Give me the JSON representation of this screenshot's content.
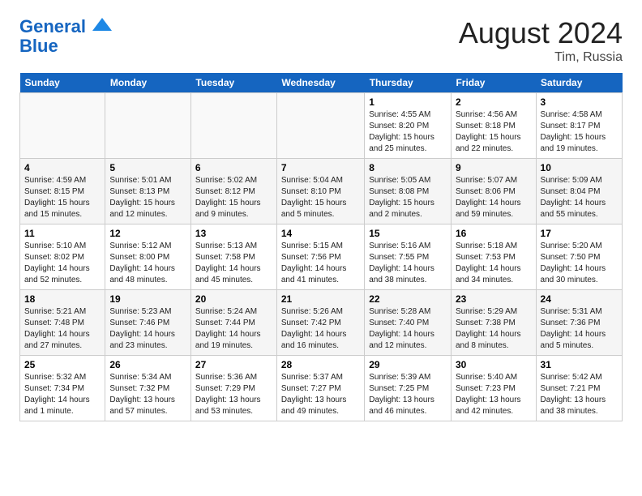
{
  "header": {
    "logo_line1": "General",
    "logo_line2": "Blue",
    "month_year": "August 2024",
    "location": "Tim, Russia"
  },
  "days_of_week": [
    "Sunday",
    "Monday",
    "Tuesday",
    "Wednesday",
    "Thursday",
    "Friday",
    "Saturday"
  ],
  "weeks": [
    [
      {
        "num": "",
        "info": ""
      },
      {
        "num": "",
        "info": ""
      },
      {
        "num": "",
        "info": ""
      },
      {
        "num": "",
        "info": ""
      },
      {
        "num": "1",
        "info": "Sunrise: 4:55 AM\nSunset: 8:20 PM\nDaylight: 15 hours\nand 25 minutes."
      },
      {
        "num": "2",
        "info": "Sunrise: 4:56 AM\nSunset: 8:18 PM\nDaylight: 15 hours\nand 22 minutes."
      },
      {
        "num": "3",
        "info": "Sunrise: 4:58 AM\nSunset: 8:17 PM\nDaylight: 15 hours\nand 19 minutes."
      }
    ],
    [
      {
        "num": "4",
        "info": "Sunrise: 4:59 AM\nSunset: 8:15 PM\nDaylight: 15 hours\nand 15 minutes."
      },
      {
        "num": "5",
        "info": "Sunrise: 5:01 AM\nSunset: 8:13 PM\nDaylight: 15 hours\nand 12 minutes."
      },
      {
        "num": "6",
        "info": "Sunrise: 5:02 AM\nSunset: 8:12 PM\nDaylight: 15 hours\nand 9 minutes."
      },
      {
        "num": "7",
        "info": "Sunrise: 5:04 AM\nSunset: 8:10 PM\nDaylight: 15 hours\nand 5 minutes."
      },
      {
        "num": "8",
        "info": "Sunrise: 5:05 AM\nSunset: 8:08 PM\nDaylight: 15 hours\nand 2 minutes."
      },
      {
        "num": "9",
        "info": "Sunrise: 5:07 AM\nSunset: 8:06 PM\nDaylight: 14 hours\nand 59 minutes."
      },
      {
        "num": "10",
        "info": "Sunrise: 5:09 AM\nSunset: 8:04 PM\nDaylight: 14 hours\nand 55 minutes."
      }
    ],
    [
      {
        "num": "11",
        "info": "Sunrise: 5:10 AM\nSunset: 8:02 PM\nDaylight: 14 hours\nand 52 minutes."
      },
      {
        "num": "12",
        "info": "Sunrise: 5:12 AM\nSunset: 8:00 PM\nDaylight: 14 hours\nand 48 minutes."
      },
      {
        "num": "13",
        "info": "Sunrise: 5:13 AM\nSunset: 7:58 PM\nDaylight: 14 hours\nand 45 minutes."
      },
      {
        "num": "14",
        "info": "Sunrise: 5:15 AM\nSunset: 7:56 PM\nDaylight: 14 hours\nand 41 minutes."
      },
      {
        "num": "15",
        "info": "Sunrise: 5:16 AM\nSunset: 7:55 PM\nDaylight: 14 hours\nand 38 minutes."
      },
      {
        "num": "16",
        "info": "Sunrise: 5:18 AM\nSunset: 7:53 PM\nDaylight: 14 hours\nand 34 minutes."
      },
      {
        "num": "17",
        "info": "Sunrise: 5:20 AM\nSunset: 7:50 PM\nDaylight: 14 hours\nand 30 minutes."
      }
    ],
    [
      {
        "num": "18",
        "info": "Sunrise: 5:21 AM\nSunset: 7:48 PM\nDaylight: 14 hours\nand 27 minutes."
      },
      {
        "num": "19",
        "info": "Sunrise: 5:23 AM\nSunset: 7:46 PM\nDaylight: 14 hours\nand 23 minutes."
      },
      {
        "num": "20",
        "info": "Sunrise: 5:24 AM\nSunset: 7:44 PM\nDaylight: 14 hours\nand 19 minutes."
      },
      {
        "num": "21",
        "info": "Sunrise: 5:26 AM\nSunset: 7:42 PM\nDaylight: 14 hours\nand 16 minutes."
      },
      {
        "num": "22",
        "info": "Sunrise: 5:28 AM\nSunset: 7:40 PM\nDaylight: 14 hours\nand 12 minutes."
      },
      {
        "num": "23",
        "info": "Sunrise: 5:29 AM\nSunset: 7:38 PM\nDaylight: 14 hours\nand 8 minutes."
      },
      {
        "num": "24",
        "info": "Sunrise: 5:31 AM\nSunset: 7:36 PM\nDaylight: 14 hours\nand 5 minutes."
      }
    ],
    [
      {
        "num": "25",
        "info": "Sunrise: 5:32 AM\nSunset: 7:34 PM\nDaylight: 14 hours\nand 1 minute."
      },
      {
        "num": "26",
        "info": "Sunrise: 5:34 AM\nSunset: 7:32 PM\nDaylight: 13 hours\nand 57 minutes."
      },
      {
        "num": "27",
        "info": "Sunrise: 5:36 AM\nSunset: 7:29 PM\nDaylight: 13 hours\nand 53 minutes."
      },
      {
        "num": "28",
        "info": "Sunrise: 5:37 AM\nSunset: 7:27 PM\nDaylight: 13 hours\nand 49 minutes."
      },
      {
        "num": "29",
        "info": "Sunrise: 5:39 AM\nSunset: 7:25 PM\nDaylight: 13 hours\nand 46 minutes."
      },
      {
        "num": "30",
        "info": "Sunrise: 5:40 AM\nSunset: 7:23 PM\nDaylight: 13 hours\nand 42 minutes."
      },
      {
        "num": "31",
        "info": "Sunrise: 5:42 AM\nSunset: 7:21 PM\nDaylight: 13 hours\nand 38 minutes."
      }
    ]
  ]
}
